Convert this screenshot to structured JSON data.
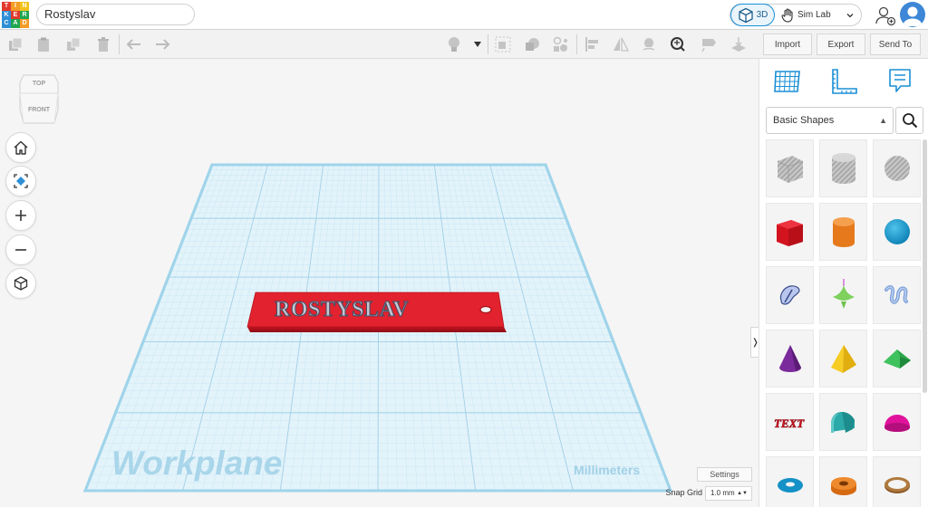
{
  "app": {
    "logo_letters": [
      "T",
      "I",
      "N",
      "K",
      "E",
      "R",
      "C",
      "A",
      "D"
    ],
    "design_title": "Rostyslav"
  },
  "header": {
    "view_3d_label": "3D",
    "sim_lab_label": "Sim Lab"
  },
  "toolbar": {
    "import_label": "Import",
    "export_label": "Export",
    "send_to_label": "Send To"
  },
  "viewport": {
    "viewcube_top": "TOP",
    "viewcube_front": "FRONT",
    "workplane_label": "Workplane",
    "units_label": "Millimeters",
    "nametag_text": "ROSTYSLAV",
    "settings_label": "Settings",
    "snap_grid_label": "Snap Grid",
    "snap_grid_value": "1.0 mm"
  },
  "panel": {
    "library_selected": "Basic Shapes",
    "shapes": [
      "box-hole",
      "cylinder-hole",
      "sphere-hole",
      "box",
      "cylinder",
      "sphere",
      "scribble",
      "shape-generator",
      "text-3d-squiggle",
      "cone",
      "pyramid",
      "roof",
      "text",
      "half-sphere",
      "paraboloid",
      "torus",
      "tube",
      "ring"
    ]
  },
  "colors": {
    "accent": "#1a8fd6",
    "workplane": "#e4f4fb",
    "workplane_border": "#a8d8ec",
    "nametag": "#e2222e"
  }
}
